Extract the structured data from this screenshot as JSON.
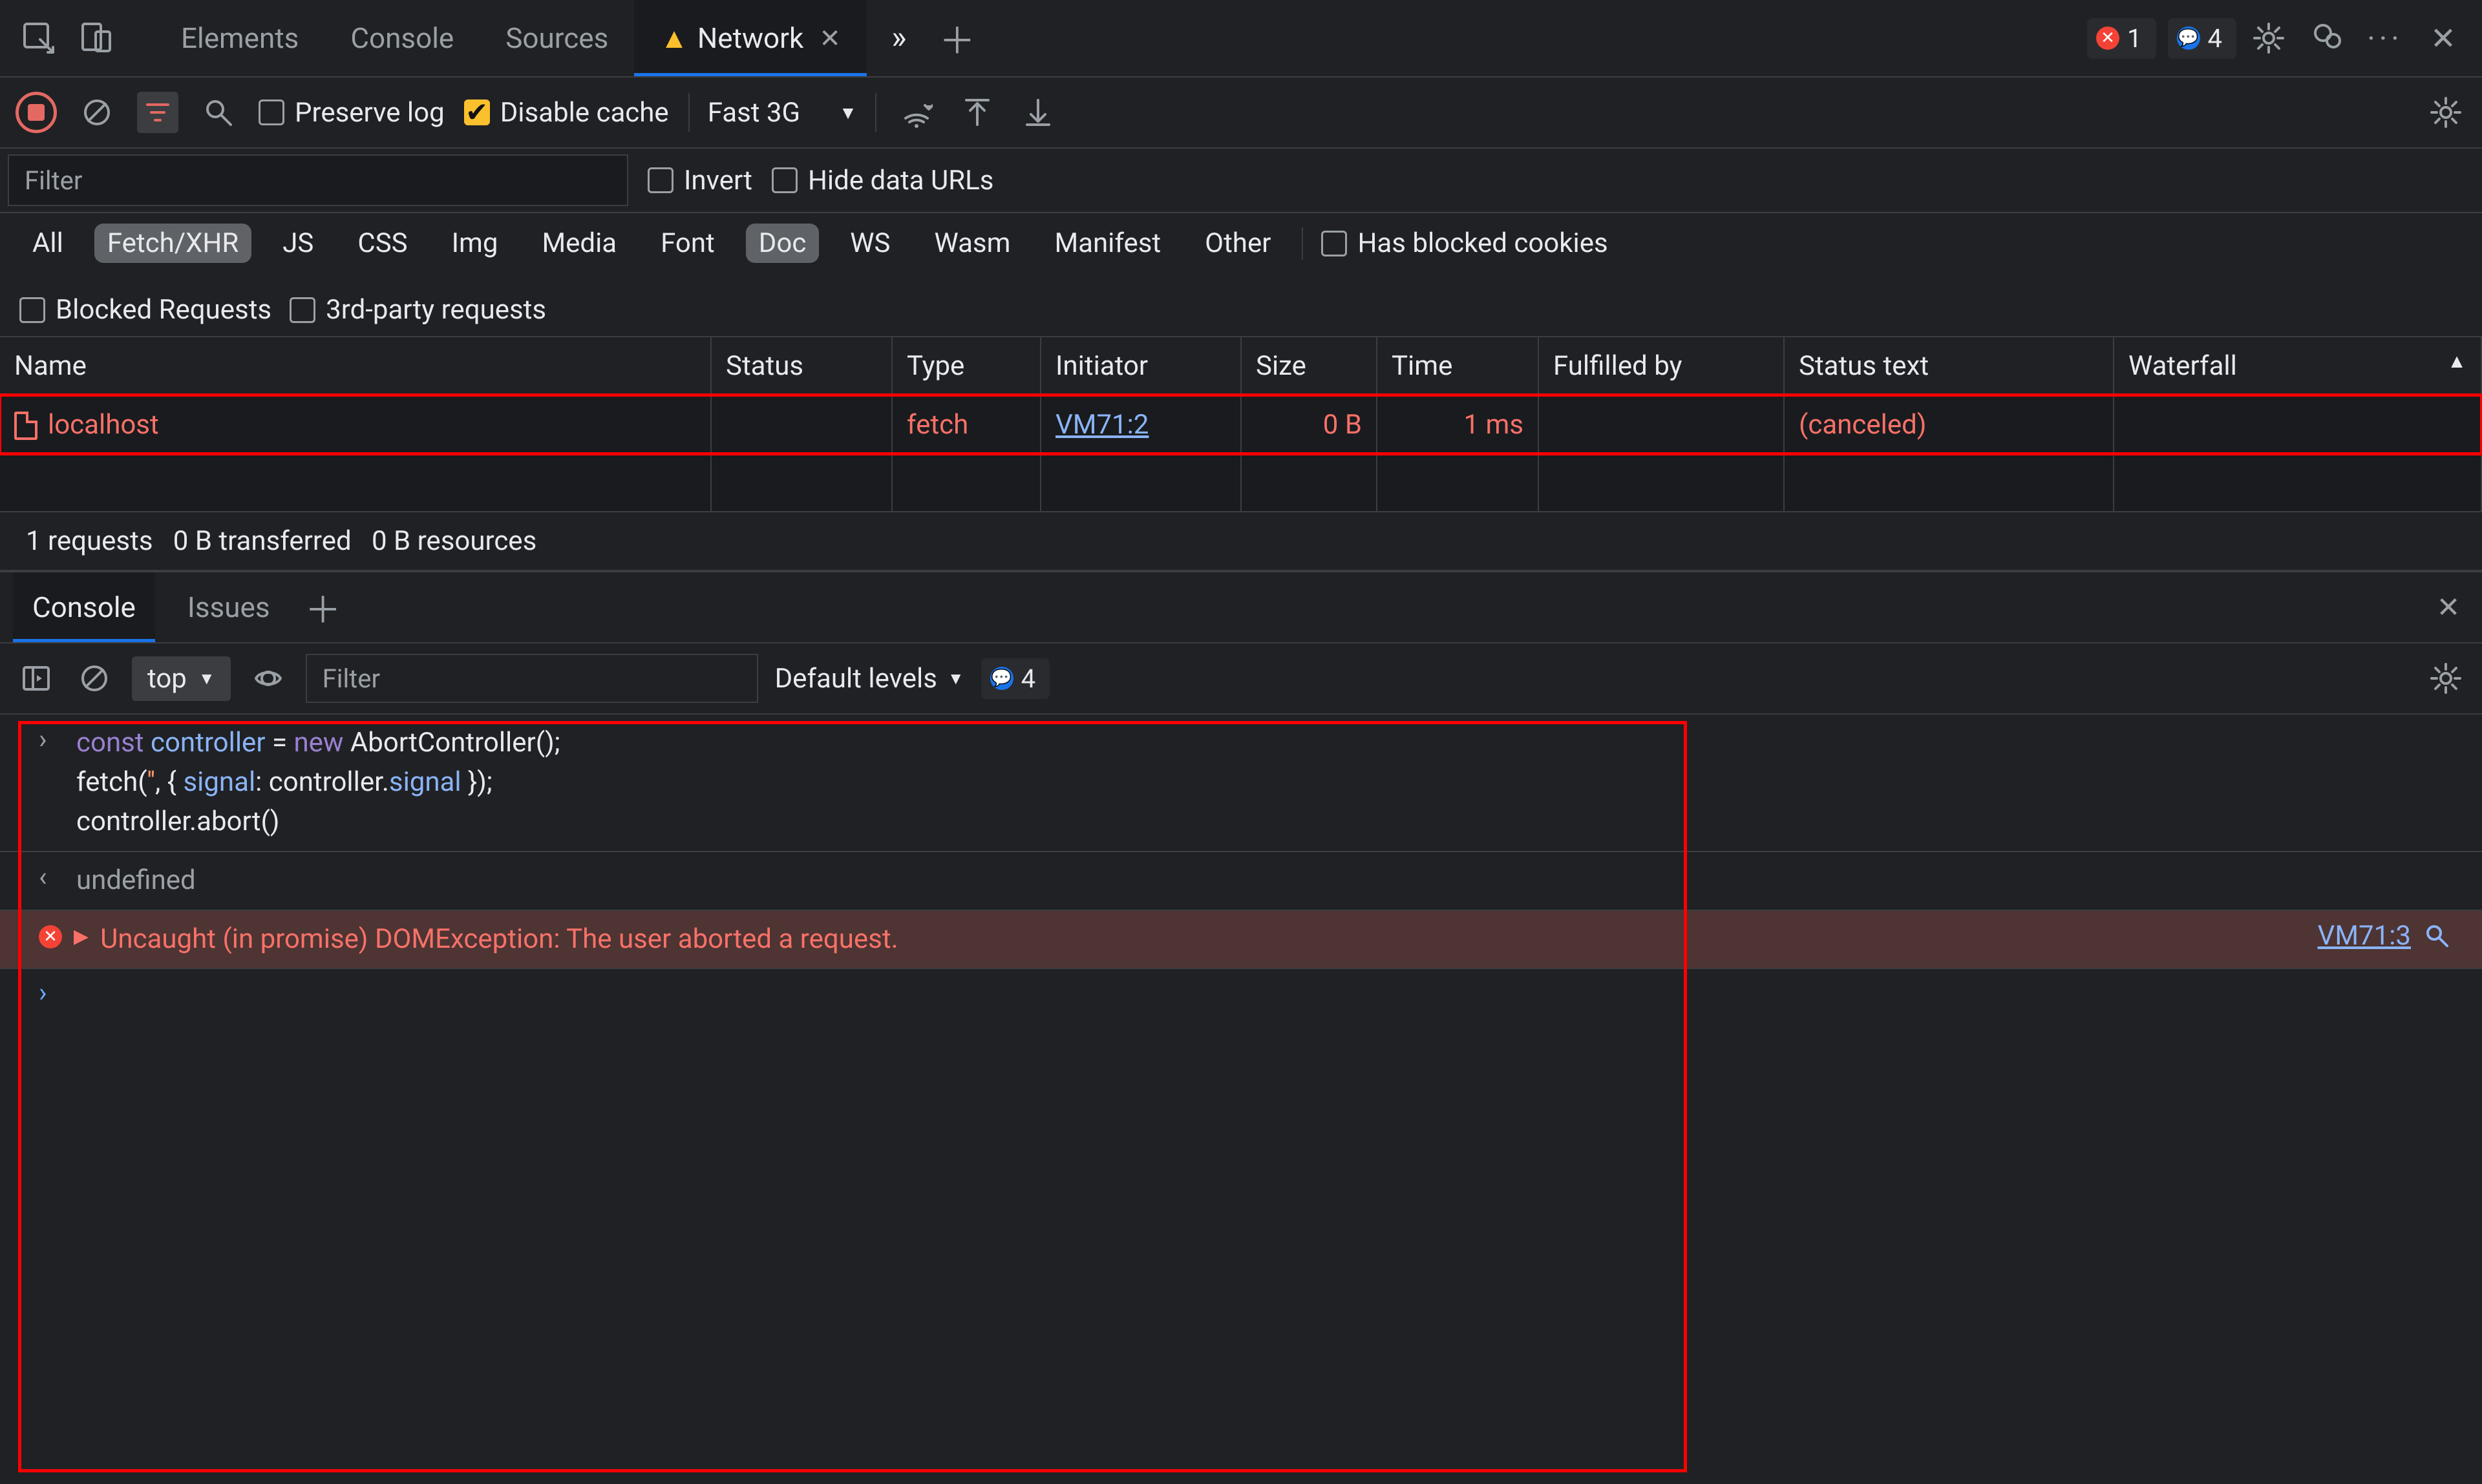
{
  "topbar": {
    "tabs": [
      "Elements",
      "Console",
      "Sources",
      "Network"
    ],
    "active_tab": "Network",
    "errors_count": "1",
    "issues_count": "4"
  },
  "network_toolbar": {
    "preserve_log_label": "Preserve log",
    "disable_cache_label": "Disable cache",
    "throttle_label": "Fast 3G"
  },
  "filterbar": {
    "filter_placeholder": "Filter",
    "invert_label": "Invert",
    "hide_data_urls_label": "Hide data URLs"
  },
  "typefilters": {
    "items": [
      "All",
      "Fetch/XHR",
      "JS",
      "CSS",
      "Img",
      "Media",
      "Font",
      "Doc",
      "WS",
      "Wasm",
      "Manifest",
      "Other"
    ],
    "active": [
      "Fetch/XHR",
      "Doc"
    ],
    "has_blocked_cookies_label": "Has blocked cookies",
    "blocked_requests_label": "Blocked Requests",
    "third_party_label": "3rd-party requests"
  },
  "columns": [
    "Name",
    "Status",
    "Type",
    "Initiator",
    "Size",
    "Time",
    "Fulfilled by",
    "Status text",
    "Waterfall"
  ],
  "requests": [
    {
      "name": "localhost",
      "status": "",
      "type": "fetch",
      "initiator": "VM71:2",
      "size": "0 B",
      "time": "1 ms",
      "fulfilled_by": "",
      "status_text": "(canceled)"
    }
  ],
  "summary": {
    "requests": "1 requests",
    "transferred": "0 B transferred",
    "resources": "0 B resources"
  },
  "drawer": {
    "tabs": [
      "Console",
      "Issues"
    ],
    "active": "Console"
  },
  "console_toolbar": {
    "context": "top",
    "filter_placeholder": "Filter",
    "levels_label": "Default levels",
    "issues_count": "4"
  },
  "console": {
    "input_lines": [
      "const controller = new AbortController();",
      "fetch('', { signal: controller.signal });",
      "controller.abort()"
    ],
    "result": "undefined",
    "error_text": "Uncaught (in promise) DOMException: The user aborted a request.",
    "error_link": "VM71:3"
  }
}
